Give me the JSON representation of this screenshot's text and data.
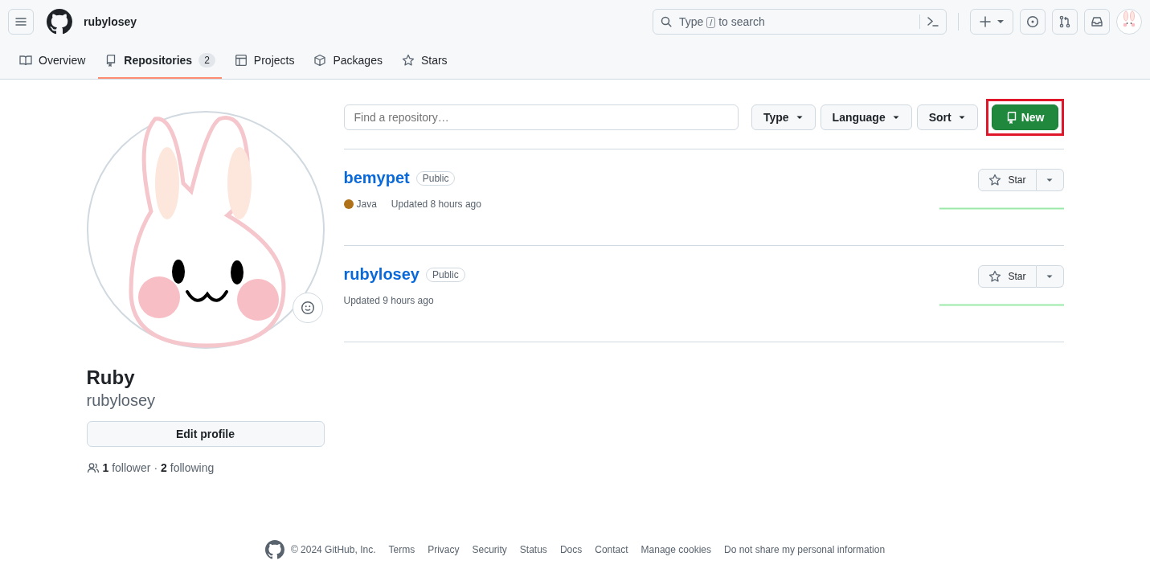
{
  "header": {
    "username": "rubylosey",
    "search": {
      "prefix": "Type",
      "key": "/",
      "suffix": "to search"
    }
  },
  "tabs": [
    {
      "label": "Overview",
      "selected": false
    },
    {
      "label": "Repositories",
      "count": "2",
      "selected": true
    },
    {
      "label": "Projects",
      "selected": false
    },
    {
      "label": "Packages",
      "selected": false
    },
    {
      "label": "Stars",
      "selected": false
    }
  ],
  "profile": {
    "name": "Ruby",
    "login": "rubylosey",
    "edit_button": "Edit profile",
    "followers_count": "1",
    "followers_label": "follower",
    "separator": "·",
    "following_count": "2",
    "following_label": "following"
  },
  "toolbar": {
    "filter_placeholder": "Find a repository…",
    "filters": [
      "Type",
      "Language",
      "Sort"
    ],
    "new_button": {
      "label": "New",
      "highlighted": true
    }
  },
  "repositories": [
    {
      "name": "bemypet",
      "visibility": "Public",
      "language": {
        "name": "Java",
        "color": "#b07219"
      },
      "updated": "Updated 8 hours ago",
      "star_label": "Star"
    },
    {
      "name": "rubylosey",
      "visibility": "Public",
      "updated": "Updated 9 hours ago",
      "star_label": "Star"
    }
  ],
  "footer": {
    "copyright": "© 2024 GitHub, Inc.",
    "links": [
      "Terms",
      "Privacy",
      "Security",
      "Status",
      "Docs",
      "Contact",
      "Manage cookies",
      "Do not share my personal information"
    ]
  }
}
